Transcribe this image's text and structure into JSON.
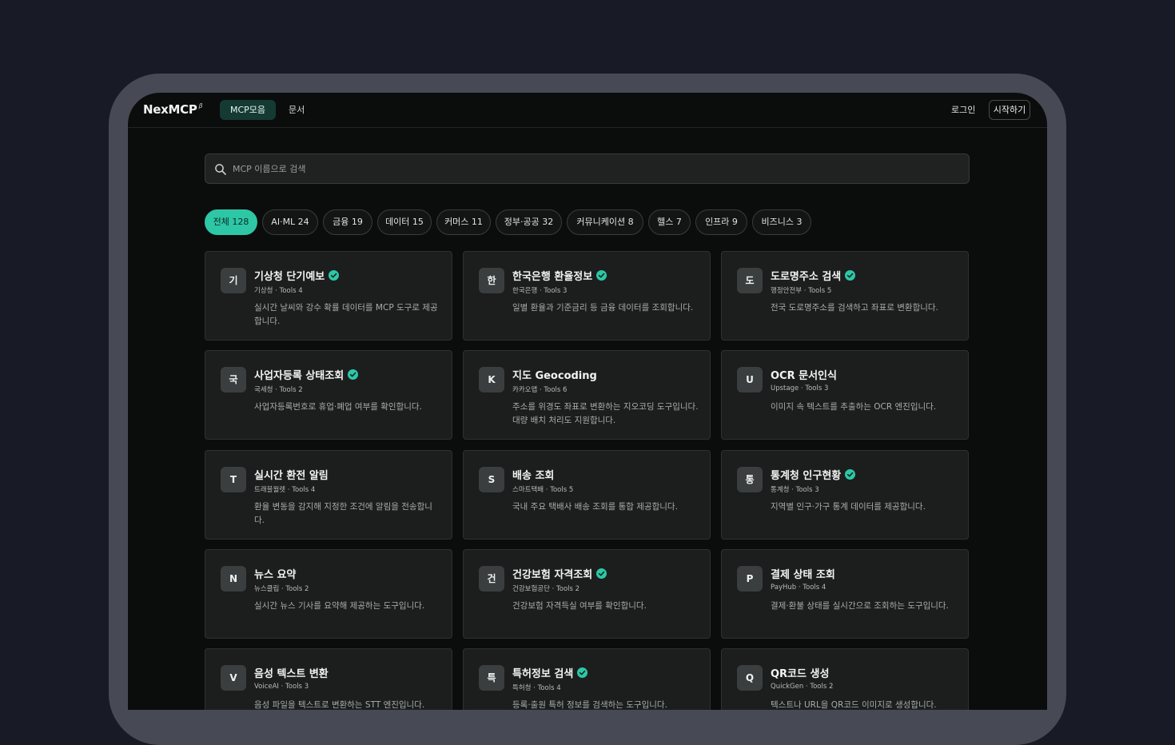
{
  "app": {
    "logo": "NexMCP",
    "logo_badge": "β"
  },
  "nav": {
    "tabs": [
      {
        "label": "MCP모음",
        "active": true
      },
      {
        "label": "문서",
        "active": false
      }
    ],
    "login_label": "로그인",
    "start_label": "시작하기"
  },
  "search": {
    "placeholder": "MCP 이름으로 검색",
    "value": ""
  },
  "colors": {
    "accent": "#2ec7a6",
    "verified": "#2ec7a6"
  },
  "filters": [
    {
      "label": "전체 128",
      "active": true
    },
    {
      "label": "AI·ML 24",
      "active": false
    },
    {
      "label": "금융 19",
      "active": false
    },
    {
      "label": "데이터 15",
      "active": false
    },
    {
      "label": "커머스 11",
      "active": false
    },
    {
      "label": "정부·공공 32",
      "active": false
    },
    {
      "label": "커뮤니케이션 8",
      "active": false
    },
    {
      "label": "헬스 7",
      "active": false
    },
    {
      "label": "인프라 9",
      "active": false
    },
    {
      "label": "비즈니스 3",
      "active": false
    }
  ],
  "cards": [
    {
      "avatar": "기",
      "title": "기상청 단기예보",
      "verified": true,
      "subtitle": "기상청 · Tools 4",
      "description": "실시간 날씨와 강수 확률 데이터를 MCP 도구로 제공합니다."
    },
    {
      "avatar": "한",
      "title": "한국은행 환율정보",
      "verified": true,
      "subtitle": "한국은행 · Tools 3",
      "description": "일별 환율과 기준금리 등 금융 데이터를 조회합니다."
    },
    {
      "avatar": "도",
      "title": "도로명주소 검색",
      "verified": true,
      "subtitle": "행정안전부 · Tools 5",
      "description": "전국 도로명주소를 검색하고 좌표로 변환합니다."
    },
    {
      "avatar": "국",
      "title": "사업자등록 상태조회",
      "verified": true,
      "subtitle": "국세청 · Tools 2",
      "description": "사업자등록번호로 휴업·폐업 여부를 확인합니다."
    },
    {
      "avatar": "K",
      "title": "지도 Geocoding",
      "verified": false,
      "subtitle": "카카오맵 · Tools 6",
      "description": "주소를 위경도 좌표로 변환하는 지오코딩 도구입니다. 대량 배치 처리도 지원합니다."
    },
    {
      "avatar": "U",
      "title": "OCR 문서인식",
      "verified": false,
      "subtitle": "Upstage · Tools 3",
      "description": "이미지 속 텍스트를 추출하는 OCR 엔진입니다."
    },
    {
      "avatar": "T",
      "title": "실시간 환전 알림",
      "verified": false,
      "subtitle": "트래블월렛 · Tools 4",
      "description": "환율 변동을 감지해 지정한 조건에 알림을 전송합니다."
    },
    {
      "avatar": "S",
      "title": "배송 조회",
      "verified": false,
      "subtitle": "스마트택배 · Tools 5",
      "description": "국내 주요 택배사 배송 조회를 통합 제공합니다."
    },
    {
      "avatar": "통",
      "title": "통계청 인구현황",
      "verified": true,
      "subtitle": "통계청 · Tools 3",
      "description": "지역별 인구·가구 통계 데이터를 제공합니다."
    },
    {
      "avatar": "N",
      "title": "뉴스 요약",
      "verified": false,
      "subtitle": "뉴스클립 · Tools 2",
      "description": "실시간 뉴스 기사를 요약해 제공하는 도구입니다."
    },
    {
      "avatar": "건",
      "title": "건강보험 자격조회",
      "verified": true,
      "subtitle": "건강보험공단 · Tools 2",
      "description": "건강보험 자격득실 여부를 확인합니다."
    },
    {
      "avatar": "P",
      "title": "결제 상태 조회",
      "verified": false,
      "subtitle": "PayHub · Tools 4",
      "description": "결제·환불 상태를 실시간으로 조회하는 도구입니다."
    },
    {
      "avatar": "V",
      "title": "음성 텍스트 변환",
      "verified": false,
      "subtitle": "VoiceAI · Tools 3",
      "description": "음성 파일을 텍스트로 변환하는 STT 엔진입니다."
    },
    {
      "avatar": "특",
      "title": "특허정보 검색",
      "verified": true,
      "subtitle": "특허청 · Tools 4",
      "description": "등록·출원 특허 정보를 검색하는 도구입니다."
    },
    {
      "avatar": "Q",
      "title": "QR코드 생성",
      "verified": false,
      "subtitle": "QuickGen · Tools 2",
      "description": "텍스트나 URL을 QR코드 이미지로 생성합니다."
    }
  ]
}
